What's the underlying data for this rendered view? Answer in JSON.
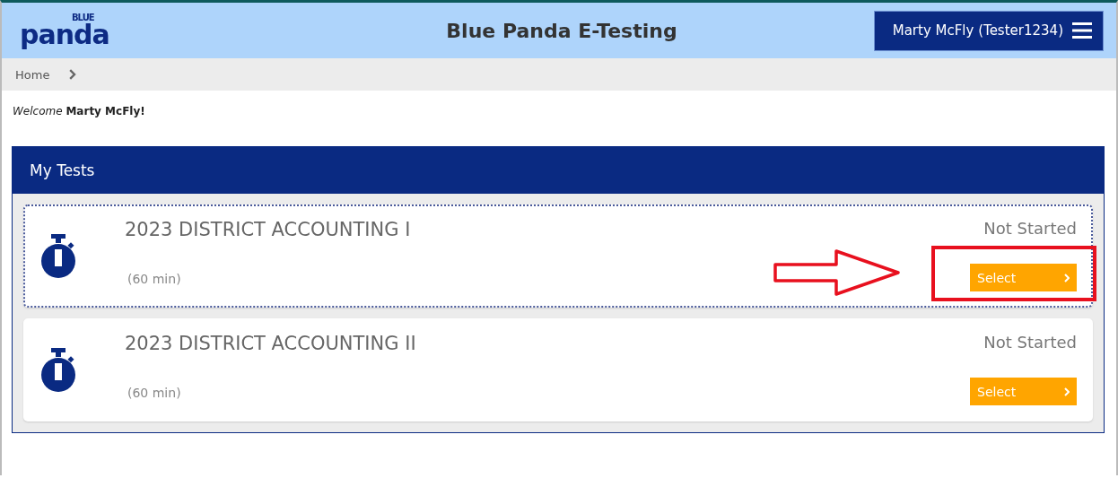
{
  "header": {
    "logo": {
      "small": "BLUE",
      "large": "panda"
    },
    "title": "Blue Panda E-Testing",
    "user_menu": "Marty McFly (Tester1234)"
  },
  "breadcrumb": [
    {
      "label": "Home"
    }
  ],
  "welcome": "*Welcome* **Marty McFly!**",
  "panel": {
    "title": "My Tests",
    "tests": [
      {
        "name": "2023 DISTRICT ACCOUNTING I",
        "duration": "(60 min)",
        "status": "Not Started",
        "button": "Select",
        "focused": true,
        "highlighted": true
      },
      {
        "name": "2023 DISTRICT ACCOUNTING II",
        "duration": "(60 min)",
        "status": "Not Started",
        "button": "Select",
        "focused": false,
        "highlighted": false
      }
    ]
  }
}
